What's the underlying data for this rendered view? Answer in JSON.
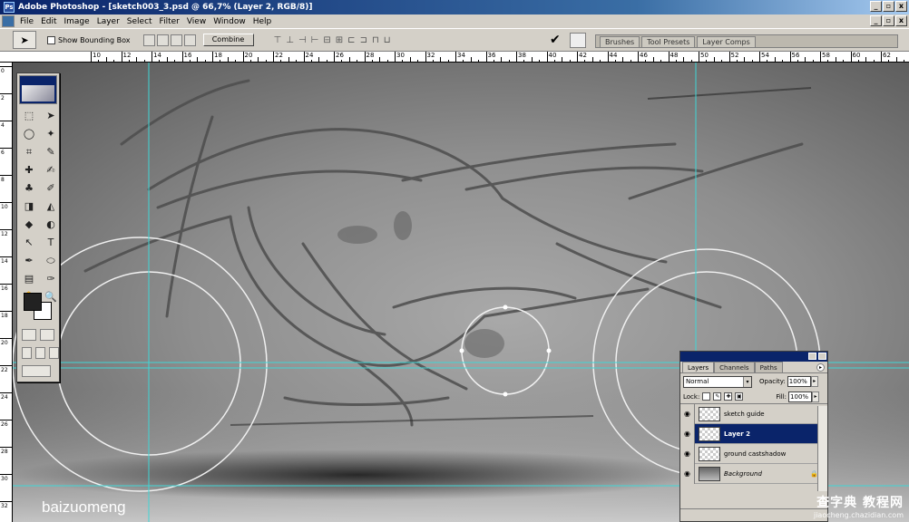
{
  "window": {
    "title": "Adobe Photoshop - [sketch003_3.psd @ 66,7% (Layer 2, RGB/8)]",
    "app_icon_text": "Ps",
    "controls": [
      "_",
      "▫",
      "x"
    ]
  },
  "menu": {
    "items": [
      "File",
      "Edit",
      "Image",
      "Layer",
      "Select",
      "Filter",
      "View",
      "Window",
      "Help"
    ]
  },
  "options_bar": {
    "tool_glyph": "➤",
    "show_bounding_box_label": "Show Bounding Box",
    "combine_label": "Combine",
    "commit_glyph": "✔",
    "align_glyphs": [
      "⊤",
      "⊥",
      "⊣",
      "⊢",
      "⊟",
      "⊞",
      "⊏",
      "⊐",
      "⊓",
      "⊔"
    ],
    "palette_well_tabs": [
      "Brushes",
      "Tool Presets",
      "Layer Comps"
    ]
  },
  "rulers": {
    "horizontal_labels": [
      "10",
      "12",
      "14",
      "16",
      "18",
      "20",
      "22",
      "24",
      "26",
      "28",
      "30",
      "32",
      "34",
      "36",
      "38",
      "40",
      "42",
      "44",
      "46",
      "48",
      "50",
      "52",
      "54",
      "56",
      "58",
      "60",
      "62",
      "64",
      "66",
      "68"
    ],
    "vertical_labels": [
      "0",
      "2",
      "4",
      "6",
      "8",
      "10",
      "12",
      "14",
      "16",
      "18",
      "20",
      "22",
      "24",
      "26",
      "28",
      "30",
      "32"
    ]
  },
  "toolbox": {
    "tools": [
      "⬚",
      "➤",
      "◯",
      "✦",
      "⌗",
      "✎",
      "✚",
      "✍",
      "♣",
      "✐",
      "◨",
      "◭",
      "◆",
      "◐",
      "↖",
      "T",
      "✒",
      "⬭",
      "▤",
      "✑",
      "✋",
      "🔍"
    ]
  },
  "layers_panel": {
    "tabs": [
      "Layers",
      "Channels",
      "Paths"
    ],
    "active_tab": "Layers",
    "blend_mode": "Normal",
    "opacity_label": "Opacity:",
    "opacity_value": "100%",
    "lock_label": "Lock:",
    "fill_label": "Fill:",
    "fill_value": "100%",
    "layers": [
      {
        "name": "sketch guide",
        "visible": true,
        "selected": false
      },
      {
        "name": "Layer 2",
        "visible": true,
        "selected": true
      },
      {
        "name": "ground castshadow",
        "visible": true,
        "selected": false
      },
      {
        "name": "Background",
        "visible": true,
        "selected": false,
        "locked": true
      }
    ]
  },
  "watermarks": {
    "left": "baizuomeng",
    "right_main": "查字典 教程网",
    "right_url": "jiaocheng.chazidian.com"
  },
  "colors": {
    "titlebar": "#0a246a",
    "chrome": "#d4d0c8",
    "guide": "#3fd6d6",
    "selected_layer": "#0a246a"
  }
}
